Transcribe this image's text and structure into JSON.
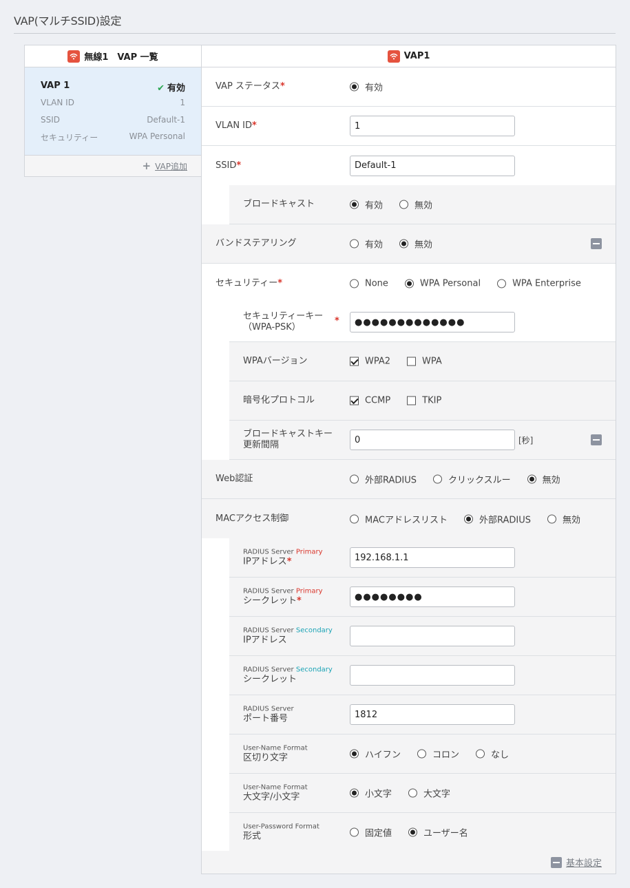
{
  "page": {
    "title": "VAP(マルチSSID)設定"
  },
  "left": {
    "header": "無線1　VAP 一覧",
    "vap": {
      "name": "VAP 1",
      "status": "有効",
      "rows": [
        {
          "label": "VLAN ID",
          "value": "1"
        },
        {
          "label": "SSID",
          "value": "Default-1"
        },
        {
          "label": "セキュリティー",
          "value": "WPA Personal"
        }
      ]
    },
    "add_label": "VAP追加"
  },
  "right": {
    "header": "VAP1",
    "vap_status": {
      "label": "VAP ステータス",
      "options": [
        "有効"
      ]
    },
    "vlan_id": {
      "label": "VLAN ID",
      "value": "1"
    },
    "ssid": {
      "label": "SSID",
      "value": "Default-1"
    },
    "broadcast": {
      "label": "ブロードキャスト",
      "options": [
        "有効",
        "無効"
      ]
    },
    "band_steering": {
      "label": "バンドステアリング",
      "options": [
        "有効",
        "無効"
      ]
    },
    "security": {
      "label": "セキュリティー",
      "options": [
        "None",
        "WPA Personal",
        "WPA Enterprise"
      ]
    },
    "security_key": {
      "label1": "セキュリティーキー",
      "label2": "（WPA-PSK）",
      "value": "●●●●●●●●●●●●●"
    },
    "wpa_version": {
      "label": "WPAバージョン",
      "options": [
        "WPA2",
        "WPA"
      ]
    },
    "encryption": {
      "label": "暗号化プロトコル",
      "options": [
        "CCMP",
        "TKIP"
      ]
    },
    "bcast_key": {
      "label1": "ブロードキャストキー",
      "label2": "更新間隔",
      "value": "0",
      "unit": "[秒]"
    },
    "web_auth": {
      "label": "Web認証",
      "options": [
        "外部RADIUS",
        "クリックスルー",
        "無効"
      ]
    },
    "mac_access": {
      "label": "MACアクセス制御",
      "options": [
        "MACアドレスリスト",
        "外部RADIUS",
        "無効"
      ]
    },
    "radius_primary_ip": {
      "small": "RADIUS Server",
      "tag": "Primary",
      "label": "IPアドレス",
      "value": "192.168.1.1"
    },
    "radius_primary_secret": {
      "small": "RADIUS Server",
      "tag": "Primary",
      "label": "シークレット",
      "value": "●●●●●●●●"
    },
    "radius_secondary_ip": {
      "small": "RADIUS Server",
      "tag": "Secondary",
      "label": "IPアドレス",
      "value": ""
    },
    "radius_secondary_secret": {
      "small": "RADIUS Server",
      "tag": "Secondary",
      "label": "シークレット",
      "value": ""
    },
    "radius_port": {
      "small": "RADIUS Server",
      "label": "ポート番号",
      "value": "1812"
    },
    "username_separator": {
      "small": "User-Name Format",
      "label": "区切り文字",
      "options": [
        "ハイフン",
        "コロン",
        "なし"
      ]
    },
    "username_case": {
      "small": "User-Name Format",
      "label": "大文字/小文字",
      "options": [
        "小文字",
        "大文字"
      ]
    },
    "password_format": {
      "small": "User-Password Format",
      "label": "形式",
      "options": [
        "固定値",
        "ユーザー名"
      ]
    },
    "footer_link": "基本設定"
  },
  "colors": {
    "accent_red": "#d9352b",
    "brand_wifi": "#e5533f",
    "secondary_teal": "#1aa3b5",
    "selected_card": "#e4effa"
  }
}
